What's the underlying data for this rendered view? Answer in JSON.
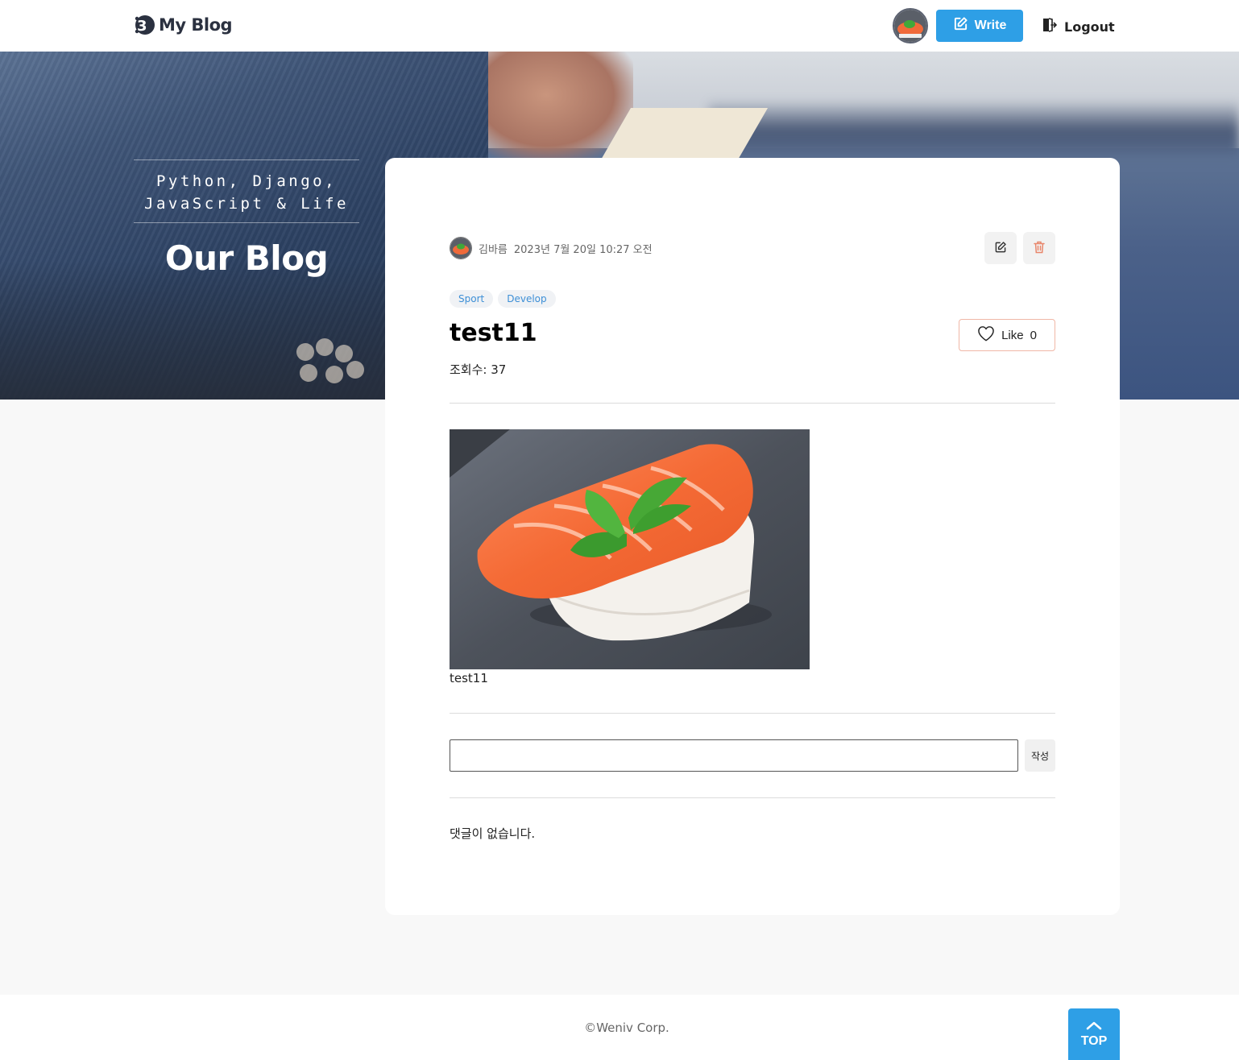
{
  "header": {
    "logo_text": "My Blog",
    "write_label": "Write",
    "logout_label": "Logout"
  },
  "hero": {
    "tagline_line1": "Python, Django,",
    "tagline_line2": "JavaScript & Life",
    "title": "Our Blog"
  },
  "post": {
    "author": "김바름",
    "date": "2023년 7월 20일 10:27 오전",
    "tags": [
      "Sport",
      "Develop"
    ],
    "title": "test11",
    "like_label": "Like",
    "like_count": "0",
    "views_label": "조회수: 37",
    "image_caption": "test11"
  },
  "comments": {
    "input_value": "",
    "submit_label": "작성",
    "empty_text": "댓글이 없습니다."
  },
  "footer": {
    "copyright": "©Weniv Corp.",
    "top_label": "TOP"
  },
  "colors": {
    "accent": "#2e9fe6",
    "tag_text": "#3d8fd6",
    "delete_icon": "#e8866b"
  }
}
